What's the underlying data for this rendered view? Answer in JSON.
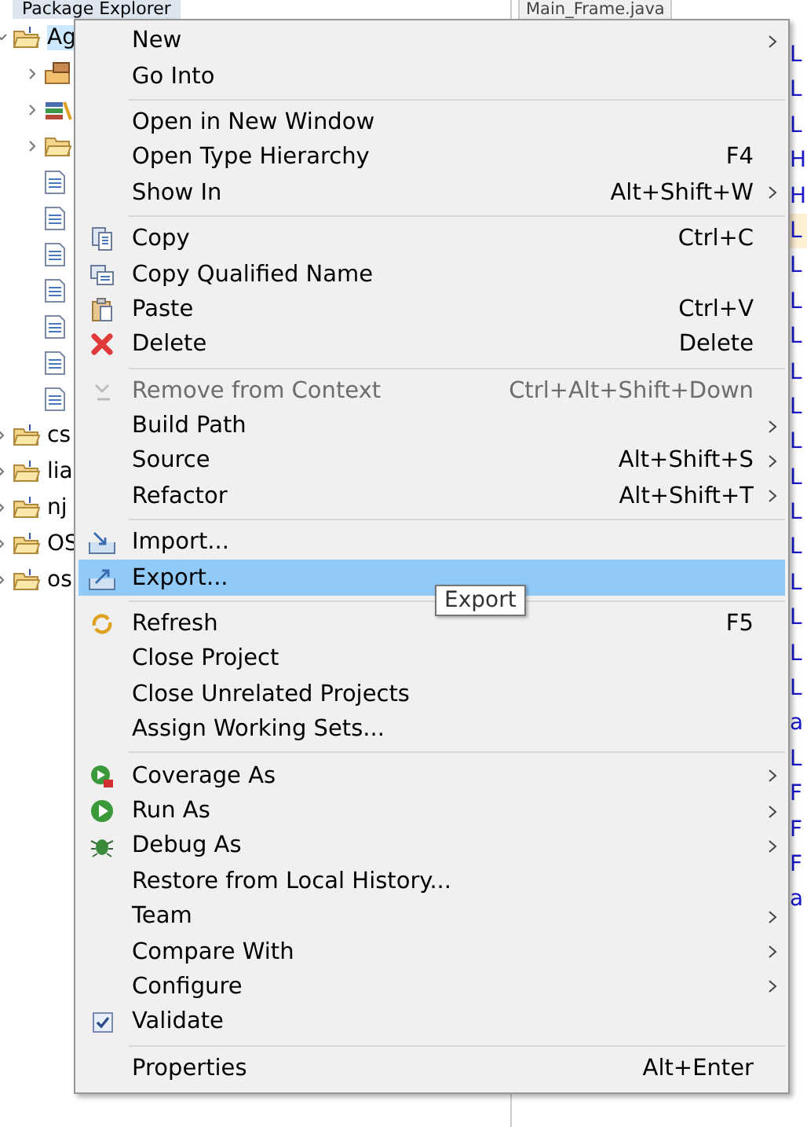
{
  "explorer": {
    "title": "Package Explorer",
    "tree": [
      {
        "label": "Ag",
        "kind": "project",
        "selected": true,
        "expanded": true,
        "children": [
          {
            "kind": "package",
            "expanded": false
          },
          {
            "kind": "library",
            "expanded": false
          },
          {
            "kind": "folder",
            "expanded": false
          },
          {
            "kind": "file"
          },
          {
            "kind": "file"
          },
          {
            "kind": "file"
          },
          {
            "kind": "file"
          },
          {
            "kind": "file"
          },
          {
            "kind": "file"
          },
          {
            "kind": "file"
          }
        ]
      },
      {
        "label": "cs",
        "kind": "project",
        "selected": false,
        "expanded": false
      },
      {
        "label": "lia",
        "kind": "project",
        "selected": false,
        "expanded": false
      },
      {
        "label": "nj",
        "kind": "project",
        "selected": false,
        "expanded": false
      },
      {
        "label": "OS",
        "kind": "project",
        "selected": false,
        "expanded": false
      },
      {
        "label": "os",
        "kind": "project",
        "selected": false,
        "expanded": false
      }
    ]
  },
  "editor": {
    "tab": "Main_Frame.java",
    "lines": [
      {
        "text": "L",
        "highlighted": false
      },
      {
        "text": "L",
        "highlighted": false
      },
      {
        "text": "L",
        "highlighted": false
      },
      {
        "text": "H",
        "highlighted": false
      },
      {
        "text": "H",
        "highlighted": false
      },
      {
        "text": "L",
        "highlighted": true
      },
      {
        "text": "L",
        "highlighted": false
      },
      {
        "text": "L",
        "highlighted": false
      },
      {
        "text": "L",
        "highlighted": false
      },
      {
        "text": "L",
        "highlighted": false
      },
      {
        "text": "L",
        "highlighted": false
      },
      {
        "text": "L",
        "highlighted": false
      },
      {
        "text": "L",
        "highlighted": false
      },
      {
        "text": "L",
        "highlighted": false
      },
      {
        "text": "L",
        "highlighted": false
      },
      {
        "text": "L",
        "highlighted": false
      },
      {
        "text": "L",
        "highlighted": false
      },
      {
        "text": "L",
        "highlighted": false
      },
      {
        "text": "L",
        "highlighted": false
      },
      {
        "text": "a",
        "highlighted": false
      },
      {
        "text": "L",
        "highlighted": false
      },
      {
        "text": "F",
        "highlighted": false
      },
      {
        "text": "F",
        "highlighted": false
      },
      {
        "text": "F",
        "highlighted": false
      },
      {
        "text": "a",
        "highlighted": false
      }
    ]
  },
  "context_menu": {
    "items": [
      {
        "kind": "item",
        "label": "New",
        "submenu": true,
        "disabled": false,
        "selected": false
      },
      {
        "kind": "item",
        "label": "Go Into",
        "submenu": false,
        "disabled": false,
        "selected": false
      },
      {
        "kind": "separator"
      },
      {
        "kind": "item",
        "label": "Open in New Window",
        "submenu": false,
        "disabled": false,
        "selected": false
      },
      {
        "kind": "item",
        "label": "Open Type Hierarchy",
        "shortcut": "F4",
        "submenu": false,
        "disabled": false,
        "selected": false
      },
      {
        "kind": "item",
        "label": "Show In",
        "shortcut": "Alt+Shift+W",
        "submenu": true,
        "disabled": false,
        "selected": false
      },
      {
        "kind": "separator"
      },
      {
        "kind": "item",
        "label": "Copy",
        "shortcut": "Ctrl+C",
        "submenu": false,
        "disabled": false,
        "selected": false
      },
      {
        "kind": "item",
        "label": "Copy Qualified Name",
        "submenu": false,
        "disabled": false,
        "selected": false
      },
      {
        "kind": "item",
        "label": "Paste",
        "shortcut": "Ctrl+V",
        "submenu": false,
        "disabled": false,
        "selected": false
      },
      {
        "kind": "item",
        "label": "Delete",
        "shortcut": "Delete",
        "submenu": false,
        "disabled": false,
        "selected": false
      },
      {
        "kind": "separator"
      },
      {
        "kind": "item",
        "label": "Remove from Context",
        "shortcut": "Ctrl+Alt+Shift+Down",
        "submenu": false,
        "disabled": true,
        "selected": false
      },
      {
        "kind": "item",
        "label": "Build Path",
        "submenu": true,
        "disabled": false,
        "selected": false
      },
      {
        "kind": "item",
        "label": "Source",
        "shortcut": "Alt+Shift+S",
        "submenu": true,
        "disabled": false,
        "selected": false
      },
      {
        "kind": "item",
        "label": "Refactor",
        "shortcut": "Alt+Shift+T",
        "submenu": true,
        "disabled": false,
        "selected": false
      },
      {
        "kind": "separator"
      },
      {
        "kind": "item",
        "label": "Import...",
        "submenu": false,
        "disabled": false,
        "selected": false
      },
      {
        "kind": "item",
        "label": "Export...",
        "submenu": false,
        "disabled": false,
        "selected": true
      },
      {
        "kind": "separator"
      },
      {
        "kind": "item",
        "label": "Refresh",
        "shortcut": "F5",
        "submenu": false,
        "disabled": false,
        "selected": false
      },
      {
        "kind": "item",
        "label": "Close Project",
        "submenu": false,
        "disabled": false,
        "selected": false
      },
      {
        "kind": "item",
        "label": "Close Unrelated Projects",
        "submenu": false,
        "disabled": false,
        "selected": false
      },
      {
        "kind": "item",
        "label": "Assign Working Sets...",
        "submenu": false,
        "disabled": false,
        "selected": false
      },
      {
        "kind": "separator"
      },
      {
        "kind": "item",
        "label": "Coverage As",
        "submenu": true,
        "disabled": false,
        "selected": false
      },
      {
        "kind": "item",
        "label": "Run As",
        "submenu": true,
        "disabled": false,
        "selected": false
      },
      {
        "kind": "item",
        "label": "Debug As",
        "submenu": true,
        "disabled": false,
        "selected": false
      },
      {
        "kind": "item",
        "label": "Restore from Local History...",
        "submenu": false,
        "disabled": false,
        "selected": false
      },
      {
        "kind": "item",
        "label": "Team",
        "submenu": true,
        "disabled": false,
        "selected": false
      },
      {
        "kind": "item",
        "label": "Compare With",
        "submenu": true,
        "disabled": false,
        "selected": false
      },
      {
        "kind": "item",
        "label": "Configure",
        "submenu": true,
        "disabled": false,
        "selected": false
      },
      {
        "kind": "check",
        "label": "Validate",
        "checked": true,
        "submenu": false,
        "disabled": false,
        "selected": false
      },
      {
        "kind": "separator"
      },
      {
        "kind": "item",
        "label": "Properties",
        "shortcut": "Alt+Enter",
        "submenu": false,
        "disabled": false,
        "selected": false
      }
    ]
  },
  "tooltip": "Export"
}
